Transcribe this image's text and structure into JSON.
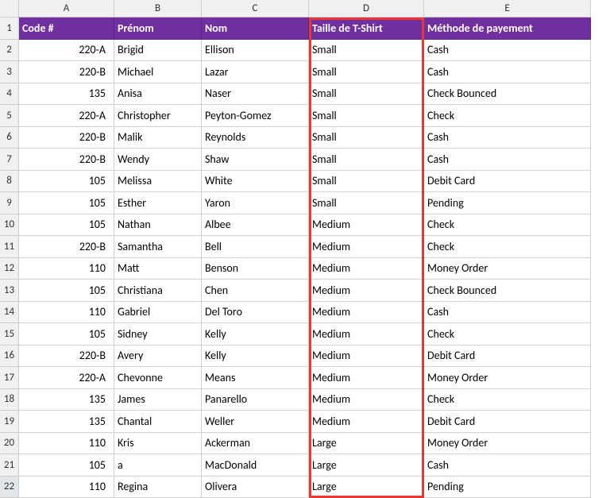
{
  "columns": {
    "A": {
      "letter": "A",
      "header": "Code #"
    },
    "B": {
      "letter": "B",
      "header": "Prénom"
    },
    "C": {
      "letter": "C",
      "header": "Nom"
    },
    "D": {
      "letter": "D",
      "header": "Taille de T-Shirt"
    },
    "E": {
      "letter": "E",
      "header": "Méthode de payement"
    }
  },
  "selected_row": 22,
  "highlighted_column": "D",
  "rows": [
    {
      "n": 2,
      "code": "220-A",
      "prenom": "Brigid",
      "nom": "Ellison",
      "taille": "Small",
      "methode": "Cash"
    },
    {
      "n": 3,
      "code": "220-B",
      "prenom": "Michael",
      "nom": "Lazar",
      "taille": "Small",
      "methode": "Cash"
    },
    {
      "n": 4,
      "code": "135",
      "prenom": "Anisa",
      "nom": "Naser",
      "taille": "Small",
      "methode": "Check Bounced"
    },
    {
      "n": 5,
      "code": "220-A",
      "prenom": "Christopher",
      "nom": "Peyton-Gomez",
      "taille": "Small",
      "methode": "Check"
    },
    {
      "n": 6,
      "code": "220-B",
      "prenom": "Malik",
      "nom": "Reynolds",
      "taille": "Small",
      "methode": "Cash"
    },
    {
      "n": 7,
      "code": "220-B",
      "prenom": "Wendy",
      "nom": "Shaw",
      "taille": "Small",
      "methode": "Cash"
    },
    {
      "n": 8,
      "code": "105",
      "prenom": "Melissa",
      "nom": "White",
      "taille": "Small",
      "methode": "Debit Card"
    },
    {
      "n": 9,
      "code": "105",
      "prenom": "Esther",
      "nom": "Yaron",
      "taille": "Small",
      "methode": "Pending"
    },
    {
      "n": 10,
      "code": "105",
      "prenom": "Nathan",
      "nom": "Albee",
      "taille": "Medium",
      "methode": "Check"
    },
    {
      "n": 11,
      "code": "220-B",
      "prenom": "Samantha",
      "nom": "Bell",
      "taille": "Medium",
      "methode": "Check"
    },
    {
      "n": 12,
      "code": "110",
      "prenom": "Matt",
      "nom": "Benson",
      "taille": "Medium",
      "methode": "Money Order"
    },
    {
      "n": 13,
      "code": "105",
      "prenom": "Christiana",
      "nom": "Chen",
      "taille": "Medium",
      "methode": "Check Bounced"
    },
    {
      "n": 14,
      "code": "110",
      "prenom": "Gabriel",
      "nom": "Del Toro",
      "taille": "Medium",
      "methode": "Cash"
    },
    {
      "n": 15,
      "code": "105",
      "prenom": "Sidney",
      "nom": "Kelly",
      "taille": "Medium",
      "methode": "Check"
    },
    {
      "n": 16,
      "code": "220-B",
      "prenom": "Avery",
      "nom": "Kelly",
      "taille": "Medium",
      "methode": "Debit Card"
    },
    {
      "n": 17,
      "code": "220-A",
      "prenom": "Chevonne",
      "nom": "Means",
      "taille": "Medium",
      "methode": "Money Order"
    },
    {
      "n": 18,
      "code": "135",
      "prenom": "James",
      "nom": "Panarello",
      "taille": "Medium",
      "methode": "Check"
    },
    {
      "n": 19,
      "code": "135",
      "prenom": "Chantal",
      "nom": "Weller",
      "taille": "Medium",
      "methode": "Debit Card"
    },
    {
      "n": 20,
      "code": "110",
      "prenom": "Kris",
      "nom": "Ackerman",
      "taille": "Large",
      "methode": "Money Order"
    },
    {
      "n": 21,
      "code": "105",
      "prenom": "a",
      "nom": "MacDonald",
      "taille": "Large",
      "methode": "Cash"
    },
    {
      "n": 22,
      "code": "110",
      "prenom": "Regina",
      "nom": "Olivera",
      "taille": "Large",
      "methode": "Pending"
    }
  ]
}
